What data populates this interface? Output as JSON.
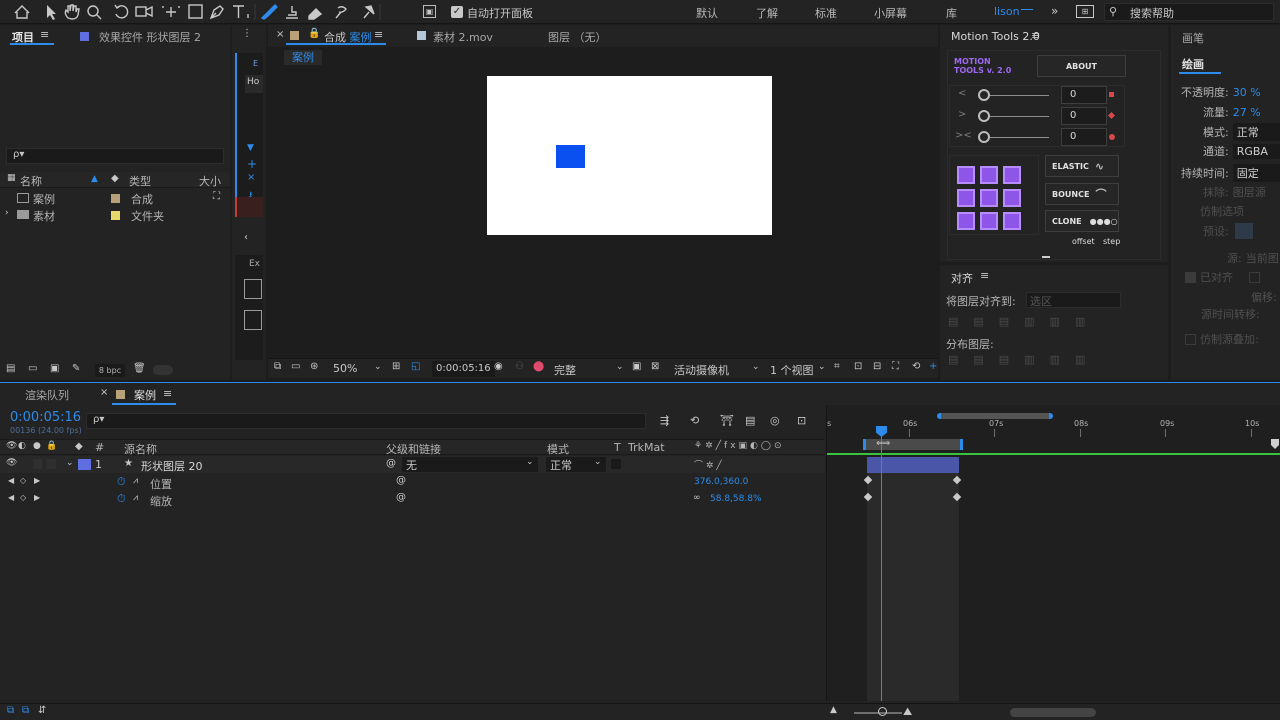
{
  "toolbar": {
    "tools": [
      "home-icon",
      "selection-icon",
      "hand-icon",
      "zoom-icon",
      "rotate-icon",
      "camera-icon",
      "anchor-icon",
      "rect-icon",
      "pen-icon",
      "type-icon",
      "brush-icon",
      "stamp-icon",
      "eraser-icon",
      "roto-icon",
      "puppet-icon"
    ],
    "auto_open_panel": "自动打开面板",
    "workspaces": [
      "默认",
      "了解",
      "标准",
      "小屏幕",
      "库"
    ],
    "user": "lison",
    "search_help": "搜索帮助"
  },
  "project_panel": {
    "title": "项目",
    "effects_tab": "效果控件 形状图层 2",
    "search_placeholder": "ρ▾",
    "columns": [
      "名称",
      "类型",
      "大小"
    ],
    "items": [
      {
        "name": "案例",
        "type": "合成"
      },
      {
        "name": "素材",
        "type": "文件夹"
      }
    ],
    "bpc": "8 bpc"
  },
  "composition": {
    "tab_comp_prefix": "合成",
    "tab_comp_name": "案例",
    "tab_footage": "素材 2.mov",
    "tab_layer": "图层 （无）",
    "breadcrumb": "案例",
    "zoom": "50%",
    "timecode": "0:00:05:16",
    "resolution": "完整",
    "camera": "活动摄像机",
    "views": "1 个视图"
  },
  "motion_tools": {
    "title": "Motion Tools 2.0",
    "logo_line1": "MOTION",
    "logo_line2": "TOOLS v. 2.0",
    "about": "ABOUT",
    "sliders": [
      {
        "label": "<",
        "value": "0"
      },
      {
        "label": ">",
        "value": "0"
      },
      {
        "label": "><",
        "value": "0"
      }
    ],
    "elastic": "ELASTIC",
    "bounce": "BOUNCE",
    "clone": "CLONE",
    "offset": "offset",
    "step": "step"
  },
  "align_panel": {
    "title": "对齐",
    "align_to_label": "将图层对齐到:",
    "align_to_value": "选区",
    "distribute_label": "分布图层:"
  },
  "paint_panel": {
    "tab": "画笔",
    "title": "绘画",
    "opacity_label": "不透明度:",
    "opacity_value": "30 %",
    "flow_label": "流量:",
    "flow_value": "27 %",
    "mode_label": "模式:",
    "mode_value": "正常",
    "channel_label": "通道:",
    "channel_value": "RGBA",
    "duration_label": "持续时间:",
    "duration_value": "固定",
    "erase_label": "抹除:",
    "erase_value": "图层源",
    "clone_options": "仿制选项",
    "preset_label": "预设:",
    "source_label": "源:",
    "source_value": "当前图",
    "aligned": "已对齐",
    "offset_label": "偏移:",
    "source_time_label": "源时间转移:",
    "clone_overlay": "仿制源叠加:"
  },
  "timeline": {
    "render_queue_tab": "渲染队列",
    "comp_tab": "案例",
    "timecode": "0:00:05:16",
    "frames": "00136 (24.00 fps)",
    "columns": {
      "num": "#",
      "source_name": "源名称",
      "parent": "父级和链接",
      "mode": "模式",
      "t": "T",
      "trkmat": "TrkMat"
    },
    "layer": {
      "index": "1",
      "name": "形状图层 20",
      "parent": "无",
      "mode": "正常"
    },
    "properties": [
      {
        "name": "位置",
        "value": "376.0,360.0"
      },
      {
        "name": "缩放",
        "value": "58.8,58.8%"
      }
    ],
    "ruler_labels": [
      "06s",
      "07s",
      "08s",
      "09s",
      "10s"
    ],
    "ruler_start": "s"
  },
  "colors": {
    "accent": "#2d8ceb",
    "layer_label": "#5f6ee0",
    "shape": "#0a4ff0",
    "mt_purple": "#8e56e8"
  }
}
